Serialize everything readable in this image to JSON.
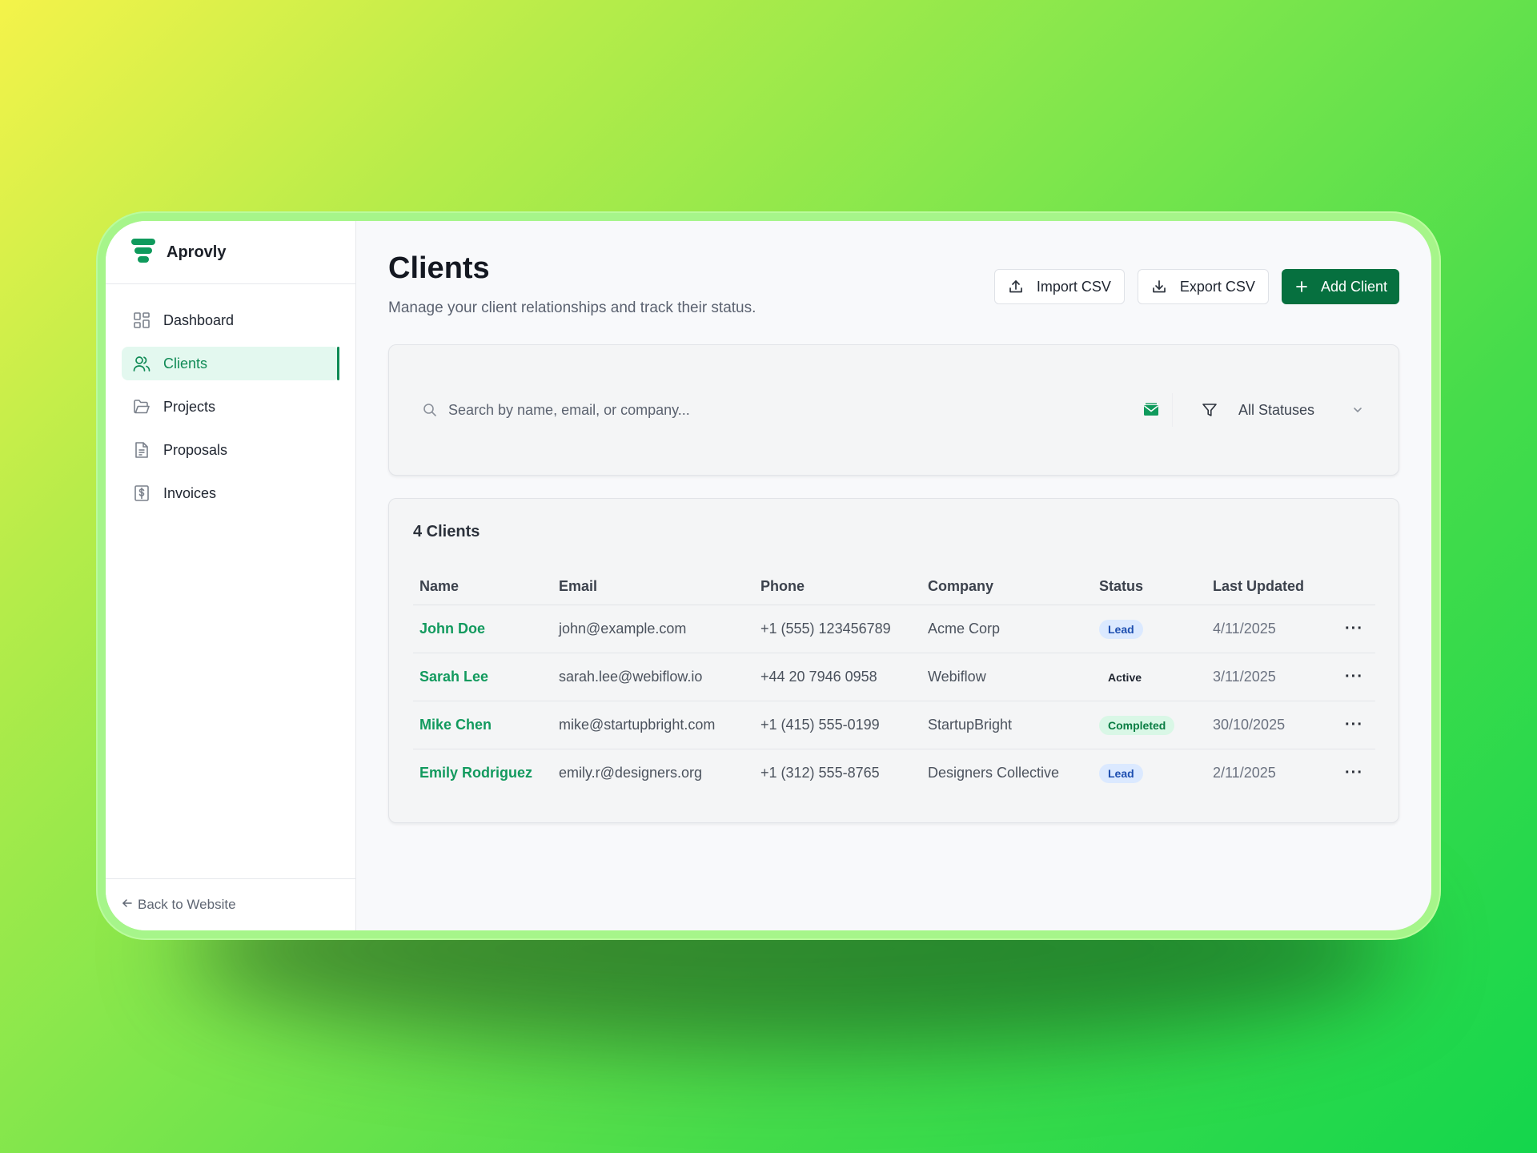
{
  "app": {
    "name": "Aprovly"
  },
  "sidebar": {
    "items": [
      {
        "label": "Dashboard",
        "icon": "dashboard-icon"
      },
      {
        "label": "Clients",
        "icon": "users-icon",
        "active": true
      },
      {
        "label": "Projects",
        "icon": "folder-icon"
      },
      {
        "label": "Proposals",
        "icon": "document-icon"
      },
      {
        "label": "Invoices",
        "icon": "dollar-receipt-icon"
      }
    ],
    "back_label": "Back to Website"
  },
  "header": {
    "title": "Clients",
    "subtitle": "Manage your client relationships and track their status.",
    "import_label": "Import CSV",
    "export_label": "Export CSV",
    "add_label": "Add Client"
  },
  "filters": {
    "search_placeholder": "Search by name, email, or company...",
    "status_value": "All Statuses"
  },
  "table": {
    "count_label": "4 Clients",
    "columns": [
      "Name",
      "Email",
      "Phone",
      "Company",
      "Status",
      "Last Updated"
    ],
    "rows": [
      {
        "name": "John Doe",
        "email": "john@example.com",
        "phone": "+1 (555) 123456789",
        "company": "Acme Corp",
        "status": "Lead",
        "updated": "4/11/2025"
      },
      {
        "name": "Sarah Lee",
        "email": "sarah.lee@webiflow.io",
        "phone": "+44 20 7946 0958",
        "company": "Webiflow",
        "status": "Active",
        "updated": "3/11/2025"
      },
      {
        "name": "Mike Chen",
        "email": "mike@startupbright.com",
        "phone": "+1 (415) 555-0199",
        "company": "StartupBright",
        "status": "Completed",
        "updated": "30/10/2025"
      },
      {
        "name": "Emily Rodriguez",
        "email": "emily.r@designers.org",
        "phone": "+1 (312) 555-8765",
        "company": "Designers Collective",
        "status": "Lead",
        "updated": "2/11/2025"
      }
    ],
    "row_action": "···"
  },
  "colors": {
    "accent": "#0f8a55",
    "primary_button": "#06703f",
    "background_start": "#f4f34a",
    "background_end": "#14d64c"
  }
}
